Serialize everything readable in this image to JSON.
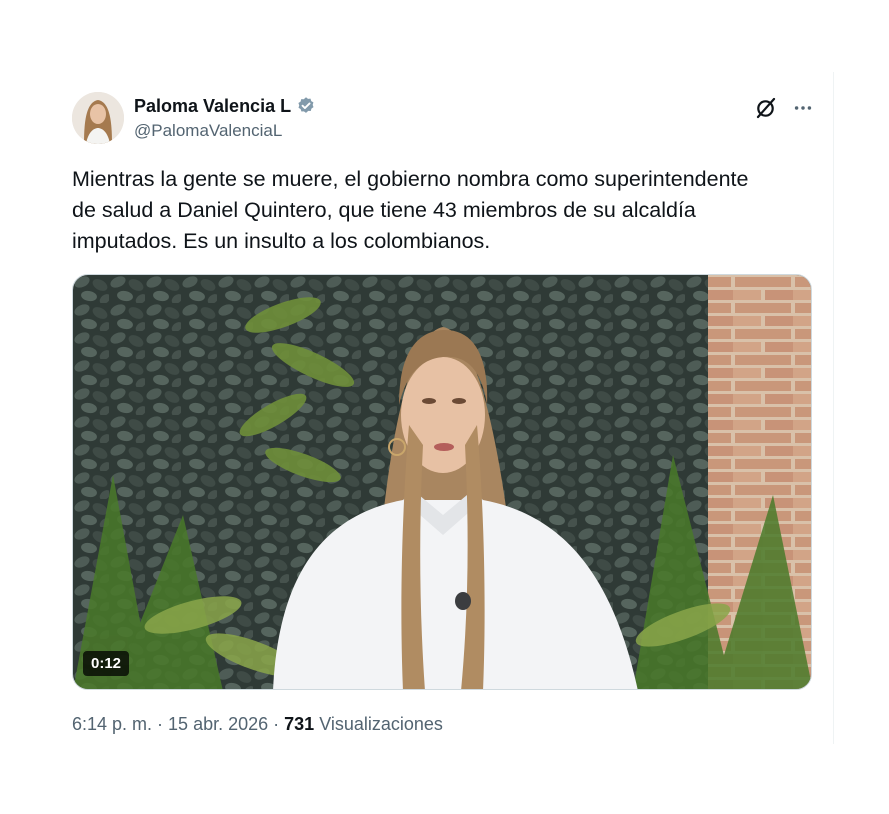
{
  "author": {
    "name": "Paloma Valencia L",
    "handle": "@PalomaValenciaL",
    "verified": true,
    "verified_color": "#829aab"
  },
  "icons": {
    "grok": "grok-icon",
    "more": "more-icon",
    "verified": "verified-badge-icon"
  },
  "tweet": {
    "line1": "Mientras la gente se muere, el gobierno nombra como superintendente",
    "line2": "de salud a Daniel Quintero, que tiene 43 miembros de su alcaldía",
    "line3": "imputados. Es un insulto a los colombianos."
  },
  "video": {
    "duration": "0:12"
  },
  "meta": {
    "time": "6:14 p. m.",
    "sep1": " · ",
    "date": "15 abr. 2026",
    "sep2": " · ",
    "views_count": "731",
    "views_label": " Visualizaciones"
  }
}
